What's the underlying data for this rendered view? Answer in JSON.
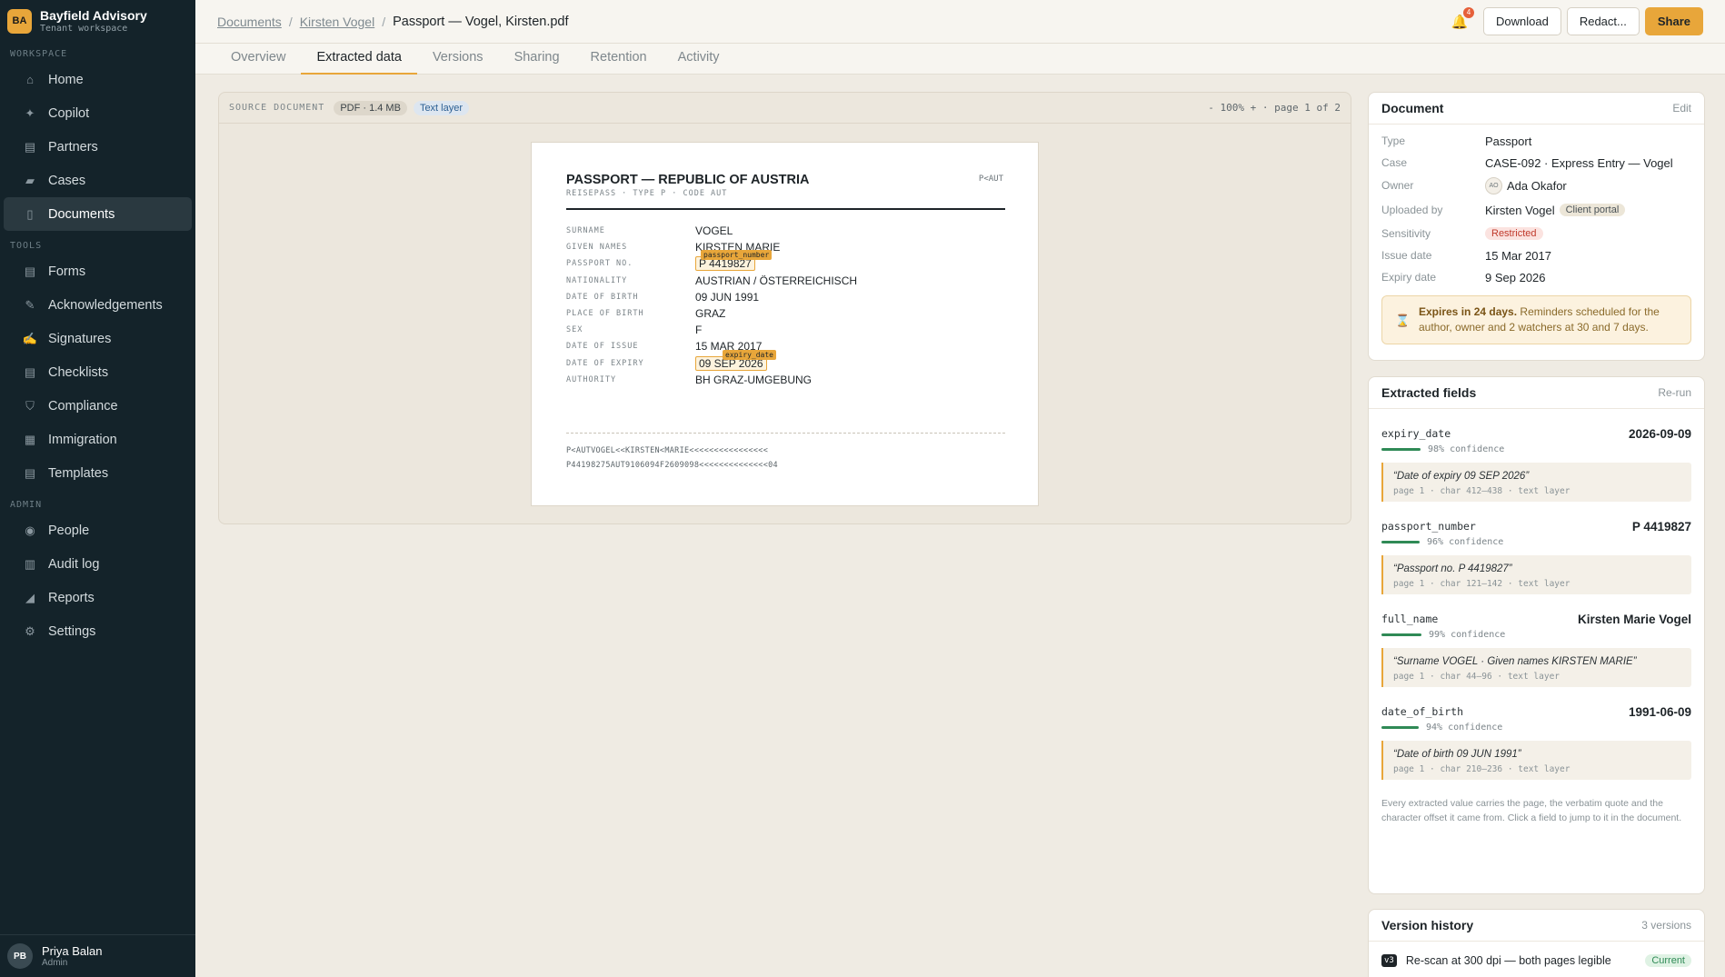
{
  "brand": {
    "badge": "BA",
    "name": "Bayfield Advisory",
    "sub": "Tenant workspace"
  },
  "sidebar": {
    "sections": [
      {
        "label": "WORKSPACE",
        "items": [
          {
            "label": "Home",
            "icon": "home-icon",
            "glyph": "⌂"
          },
          {
            "label": "Copilot",
            "icon": "sparkle-icon",
            "glyph": "✦"
          },
          {
            "label": "Partners",
            "icon": "clipboard-icon",
            "glyph": "▤"
          },
          {
            "label": "Cases",
            "icon": "folder-icon",
            "glyph": "▰"
          },
          {
            "label": "Documents",
            "icon": "document-icon",
            "glyph": "▯",
            "active": true
          }
        ]
      },
      {
        "label": "TOOLS",
        "items": [
          {
            "label": "Forms",
            "icon": "form-icon",
            "glyph": "▤"
          },
          {
            "label": "Acknowledgements",
            "icon": "pen-icon",
            "glyph": "✎"
          },
          {
            "label": "Signatures",
            "icon": "signature-icon",
            "glyph": "✍"
          },
          {
            "label": "Checklists",
            "icon": "checklist-icon",
            "glyph": "▤"
          },
          {
            "label": "Compliance",
            "icon": "shield-icon",
            "glyph": "⛉"
          },
          {
            "label": "Immigration",
            "icon": "globe-icon",
            "glyph": "▦"
          },
          {
            "label": "Templates",
            "icon": "template-icon",
            "glyph": "▤"
          }
        ]
      },
      {
        "label": "ADMIN",
        "items": [
          {
            "label": "People",
            "icon": "people-icon",
            "glyph": "◉"
          },
          {
            "label": "Audit log",
            "icon": "bar-chart-icon",
            "glyph": "▥"
          },
          {
            "label": "Reports",
            "icon": "line-chart-icon",
            "glyph": "◢"
          },
          {
            "label": "Settings",
            "icon": "gear-icon",
            "glyph": "⚙"
          }
        ]
      }
    ]
  },
  "user": {
    "initials": "PB",
    "name": "Priya Balan",
    "role": "Admin"
  },
  "breadcrumb": {
    "root": "Documents",
    "parent": "Kirsten Vogel",
    "current": "Passport — Vogel, Kirsten.pdf"
  },
  "topbar": {
    "notif_count": "4",
    "download": "Download",
    "redact": "Redact...",
    "share": "Share"
  },
  "tabs": [
    "Overview",
    "Extracted data",
    "Versions",
    "Sharing",
    "Retention",
    "Activity"
  ],
  "source": {
    "label": "SOURCE DOCUMENT",
    "format": "PDF · 1.4 MB",
    "layer": "Text layer",
    "zoom_text": "- 100% + · page 1 of 2"
  },
  "passport": {
    "title": "PASSPORT — REPUBLIC OF AUSTRIA",
    "subtitle": "REISEPASS · TYPE P · CODE AUT",
    "code": "P<AUT",
    "rows": [
      {
        "key": "SURNAME",
        "value": "VOGEL"
      },
      {
        "key": "GIVEN NAMES",
        "value": "KIRSTEN MARIE"
      },
      {
        "key": "PASSPORT NO.",
        "value": "P 4419827",
        "tag": "passport_number"
      },
      {
        "key": "NATIONALITY",
        "value": "AUSTRIAN / ÖSTERREICHISCH"
      },
      {
        "key": "DATE OF BIRTH",
        "value": "09 JUN 1991"
      },
      {
        "key": "PLACE OF BIRTH",
        "value": "GRAZ"
      },
      {
        "key": "SEX",
        "value": "F"
      },
      {
        "key": "DATE OF ISSUE",
        "value": "15 MAR 2017"
      },
      {
        "key": "DATE OF EXPIRY",
        "value": "09 SEP 2026",
        "tag": "expiry_date"
      },
      {
        "key": "AUTHORITY",
        "value": "BH GRAZ-UMGEBUNG"
      }
    ],
    "mrz": [
      "P<AUTVOGEL<<KIRSTEN<MARIE<<<<<<<<<<<<<<<<",
      "P44198275AUT9106094F2609098<<<<<<<<<<<<<<04"
    ]
  },
  "doc_card": {
    "title": "Document",
    "edit": "Edit",
    "type_label": "Type",
    "type": "Passport",
    "case_label": "Case",
    "case": "CASE-092 · Express Entry — Vogel",
    "owner_label": "Owner",
    "owner_initials": "AO",
    "owner": "Ada Okafor",
    "uploaded_label": "Uploaded by",
    "uploaded": "Kirsten Vogel",
    "uploaded_tag": "Client portal",
    "sensitivity_label": "Sensitivity",
    "sensitivity": "Restricted",
    "issue_label": "Issue date",
    "issue": "15 Mar 2017",
    "expiry_label": "Expiry date",
    "expiry": "9 Sep 2026",
    "alert_bold": "Expires in 24 days.",
    "alert_text": " Reminders scheduled for the author, owner and 2 watchers at 30 and 7 days."
  },
  "fields_card": {
    "title": "Extracted fields",
    "rerun": "Re-run",
    "fields": [
      {
        "name": "expiry_date",
        "value": "2026-09-09",
        "confidence": 0.98,
        "conf_text": "98% confidence",
        "quote": "“Date of expiry  09 SEP 2026”",
        "source": "page 1 · char 412–438 · text layer"
      },
      {
        "name": "passport_number",
        "value": "P 4419827",
        "confidence": 0.96,
        "conf_text": "96% confidence",
        "quote": "“Passport no.  P 4419827”",
        "source": "page 1 · char 121–142 · text layer"
      },
      {
        "name": "full_name",
        "value": "Kirsten Marie Vogel",
        "confidence": 0.99,
        "conf_text": "99% confidence",
        "quote": "“Surname VOGEL · Given names KIRSTEN MARIE”",
        "source": "page 1 · char 44–96 · text layer"
      },
      {
        "name": "date_of_birth",
        "value": "1991-06-09",
        "confidence": 0.94,
        "conf_text": "94% confidence",
        "quote": "“Date of birth  09 JUN 1991”",
        "source": "page 1 · char 210–236 · text layer"
      }
    ],
    "note": "Every extracted value carries the page, the verbatim quote and the character offset it came from. Click a field to jump to it in the document."
  },
  "version_card": {
    "title": "Version history",
    "count": "3 versions",
    "latest_badge": "v3",
    "latest_text": "Re-scan at 300 dpi — both pages legible",
    "latest_tag": "Current"
  }
}
